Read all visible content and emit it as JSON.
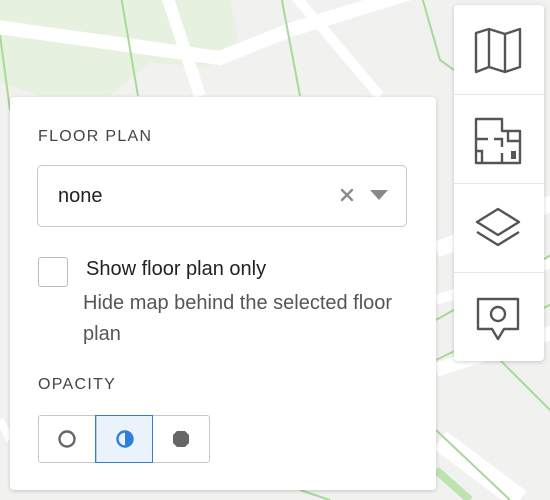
{
  "floor_plan": {
    "title": "FLOOR PLAN",
    "select_value": "none",
    "clear_icon": "close-icon",
    "dropdown_icon": "chevron-down-icon",
    "show_only_label": "Show floor plan only",
    "show_only_checked": false,
    "show_only_description": "Hide map behind the selected floor plan"
  },
  "opacity": {
    "title": "OPACITY",
    "options": [
      {
        "icon": "circle-outline-icon",
        "selected": false
      },
      {
        "icon": "half-circle-icon",
        "selected": true
      },
      {
        "icon": "circle-filled-icon",
        "selected": false
      }
    ],
    "accent_color": "#2f7ed8"
  },
  "toolbar": {
    "buttons": [
      {
        "icon": "map-icon"
      },
      {
        "icon": "floor-plan-icon"
      },
      {
        "icon": "layers-icon"
      },
      {
        "icon": "location-marker-icon"
      }
    ]
  },
  "colors": {
    "map_background": "#f1f1ef",
    "map_green": "#bde3b0",
    "icon_gray": "#555555"
  }
}
